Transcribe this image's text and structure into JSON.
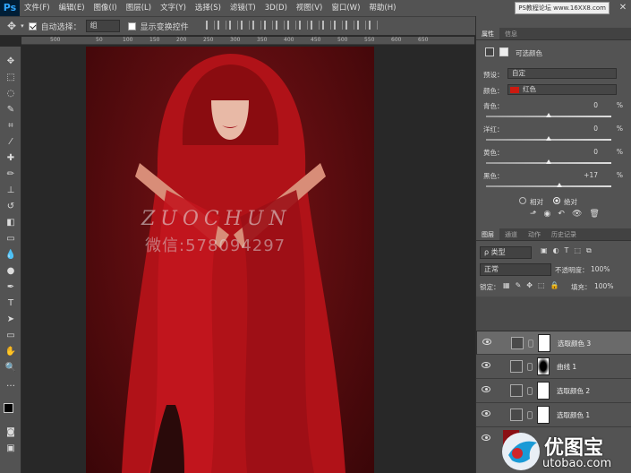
{
  "app": {
    "logo": "Ps"
  },
  "menu": [
    "文件(F)",
    "编辑(E)",
    "图像(I)",
    "图层(L)",
    "文字(Y)",
    "选择(S)",
    "滤镜(T)",
    "3D(D)",
    "视图(V)",
    "窗口(W)",
    "帮助(H)"
  ],
  "watermark_top": "PS教程论坛 www.16XX8.com",
  "window_controls": [
    "—",
    "□",
    "✕"
  ],
  "options": {
    "auto_select_label": "自动选择：",
    "auto_select_value": "组",
    "transform_label": "显示变换控件",
    "threeD_label": "3D 模"
  },
  "ruler": {
    "ticks": [
      "500",
      "50",
      "100",
      "150",
      "200",
      "250",
      "300",
      "350",
      "400",
      "450",
      "500",
      "550",
      "600",
      "650"
    ]
  },
  "canvas": {
    "watermark_text": "ZUOCHUN",
    "watermark_contact": "微信:578094297"
  },
  "properties": {
    "tabs": [
      "属性",
      "信息"
    ],
    "title": "可选颜色",
    "preset_label": "预设：",
    "preset_value": "自定",
    "color_label": "颜色：",
    "color_value": "红色",
    "color_swatch": "#cc1a10",
    "sliders": [
      {
        "label": "青色：",
        "value": "0",
        "unit": "%",
        "pos": 0.5
      },
      {
        "label": "洋红：",
        "value": "0",
        "unit": "%",
        "pos": 0.5
      },
      {
        "label": "黄色：",
        "value": "0",
        "unit": "%",
        "pos": 0.5
      },
      {
        "label": "黑色：",
        "value": "+17",
        "unit": "%",
        "pos": 0.585
      }
    ],
    "method_relative": "相对",
    "method_absolute": "绝对"
  },
  "layers": {
    "tabs": [
      "图层",
      "通道",
      "动作",
      "历史记录"
    ],
    "filter_label": "ρ 类型",
    "blend_mode": "正常",
    "opacity_label": "不透明度：",
    "opacity_value": "100%",
    "lock_label": "锁定：",
    "fill_label": "填充：",
    "fill_value": "100%",
    "items": [
      {
        "name": "选取颜色 3",
        "selected": true
      },
      {
        "name": "曲线 1",
        "selected": false
      },
      {
        "name": "选取颜色 2",
        "selected": false
      },
      {
        "name": "选取颜色 1",
        "selected": false
      }
    ]
  },
  "brand": {
    "name": "优图宝",
    "url": "utobao.com"
  }
}
